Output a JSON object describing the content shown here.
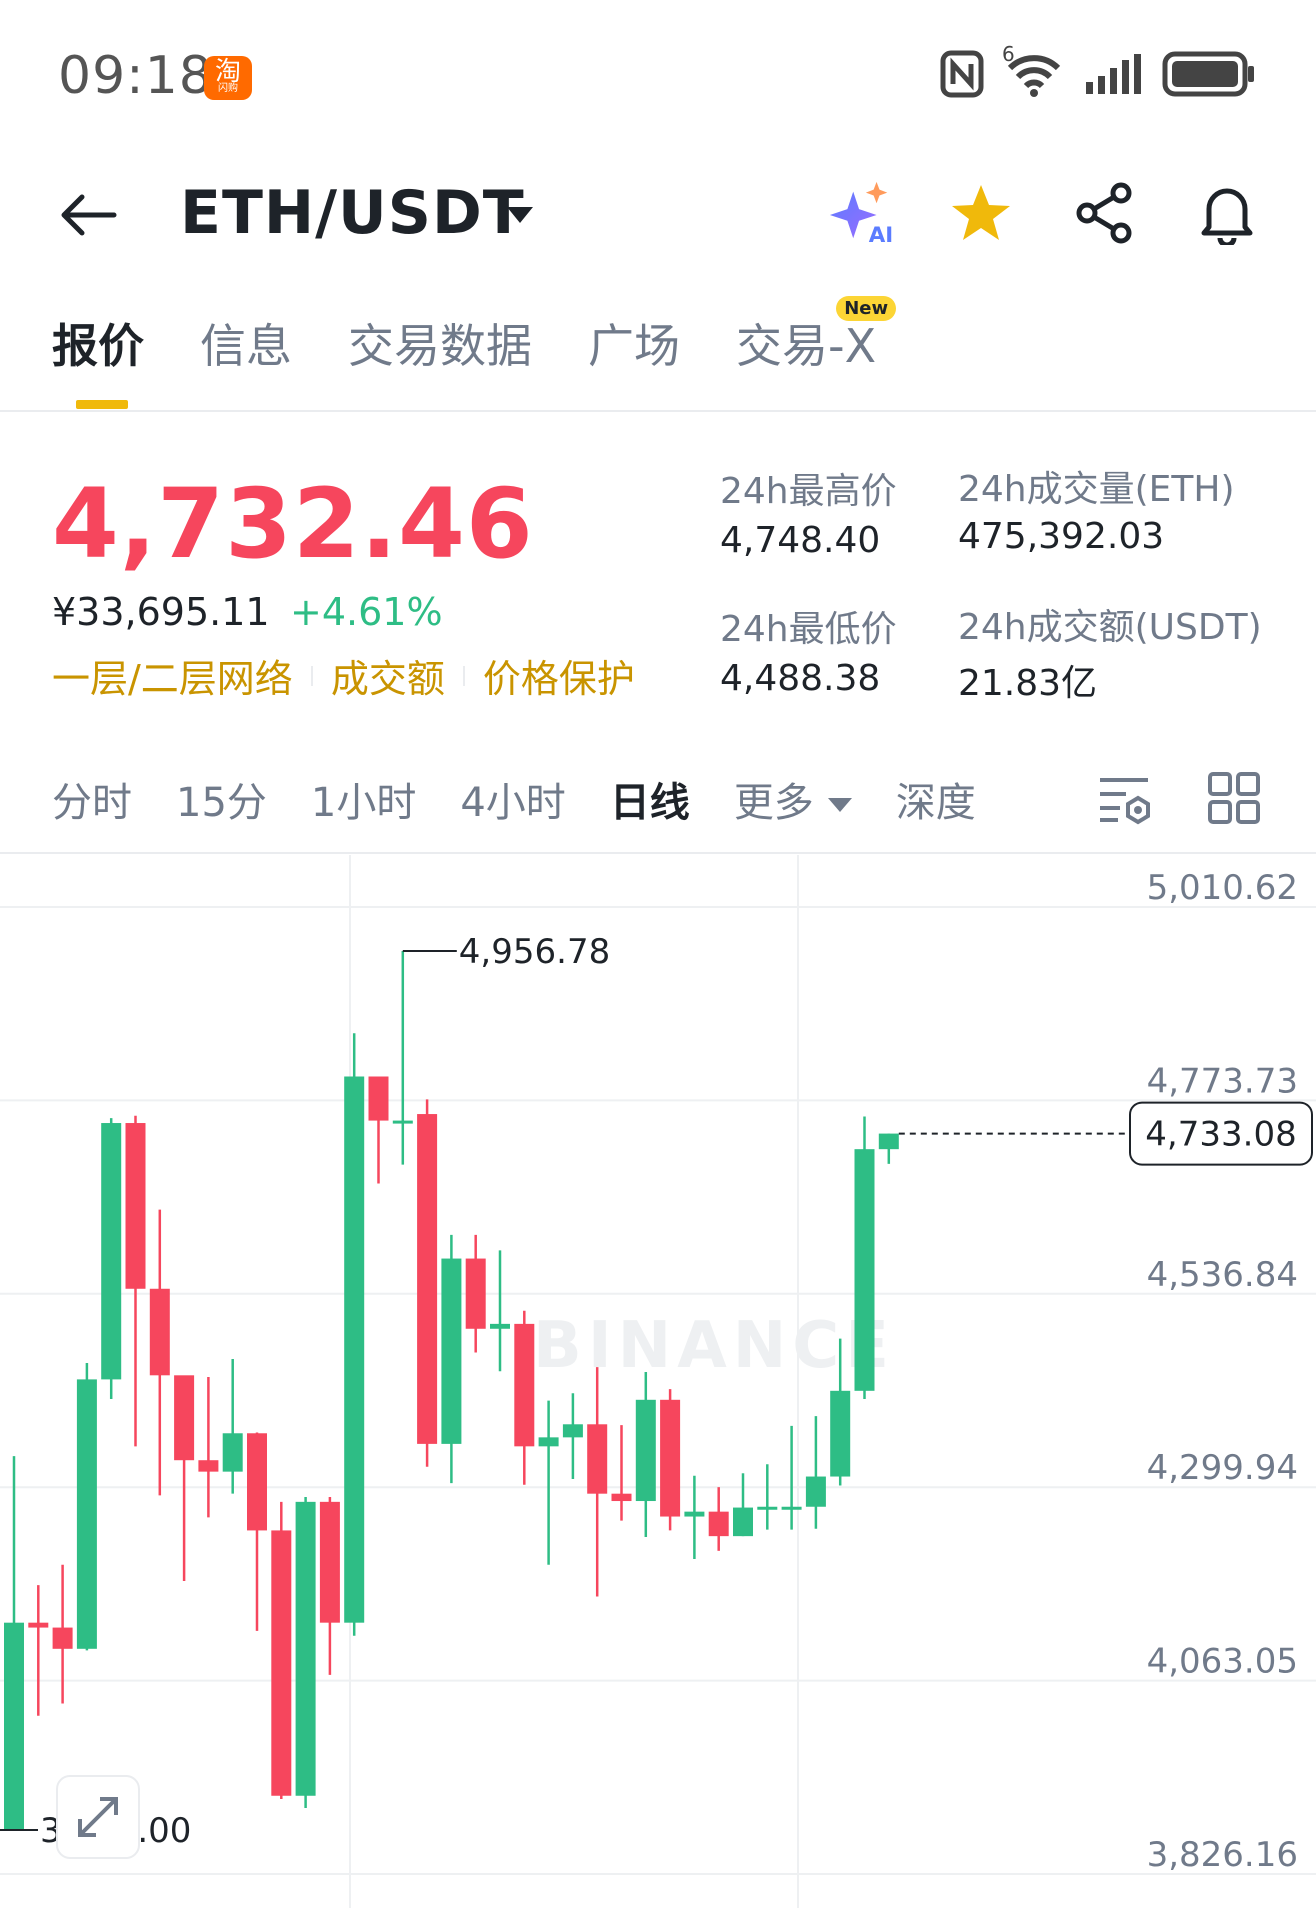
{
  "status_bar": {
    "time": "09:18",
    "app_badge": "淘",
    "app_badge_sub": "闪购",
    "wifi_generation": "6"
  },
  "header": {
    "pair": "ETH/USDT",
    "icons": [
      "back-arrow-icon",
      "ai-sparkle-icon",
      "star-icon",
      "share-icon",
      "bell-icon"
    ],
    "ai_badge": "AI"
  },
  "tabs": [
    {
      "label": "报价",
      "active": true
    },
    {
      "label": "信息"
    },
    {
      "label": "交易数据"
    },
    {
      "label": "广场"
    },
    {
      "label": "交易-X",
      "badge": "New"
    }
  ],
  "ticker": {
    "last_price": "4,732.46",
    "cny_price": "¥33,695.11",
    "change_pct": "+4.61%",
    "links": [
      "一层/二层网络",
      "成交额",
      "价格保护"
    ],
    "high_label": "24h最高价",
    "high_value": "4,748.40",
    "low_label": "24h最低价",
    "low_value": "4,488.38",
    "vol_base_label": "24h成交量(ETH)",
    "vol_base_value": "475,392.03",
    "vol_quote_label": "24h成交额(USDT)",
    "vol_quote_value": "21.83亿"
  },
  "intervals": {
    "items": [
      "分时",
      "15分",
      "1小时",
      "4小时",
      "日线",
      "更多",
      "深度"
    ],
    "active": "日线"
  },
  "colors": {
    "up": "#2ebd85",
    "down": "#f6465d",
    "accent": "#f0b90b",
    "link": "#c99400"
  },
  "chart_data": {
    "type": "candlestick",
    "interval": "日线",
    "watermark": "BINANCE",
    "y_ticks": [
      5010.62,
      4773.73,
      4536.84,
      4299.94,
      4063.05,
      3826.16
    ],
    "y_tick_labels": [
      "5,010.62",
      "4,773.73",
      "4,536.84",
      "4,299.94",
      "4,063.05",
      "3,826.16"
    ],
    "ylim": [
      3826.16,
      5010.62
    ],
    "high_marker": {
      "label": "4,956.78",
      "value": 4956.78
    },
    "low_marker": {
      "label": "3,880.00",
      "value": 3880.0
    },
    "current_price": {
      "label": "4,733.08",
      "value": 4733.08
    },
    "candles": [
      {
        "o": 3880,
        "h": 4338,
        "l": 3880,
        "c": 4134
      },
      {
        "o": 4134,
        "h": 4180,
        "l": 4020,
        "c": 4128
      },
      {
        "o": 4128,
        "h": 4205,
        "l": 4035,
        "c": 4102
      },
      {
        "o": 4102,
        "h": 4452,
        "l": 4100,
        "c": 4432
      },
      {
        "o": 4432,
        "h": 4752,
        "l": 4408,
        "c": 4746
      },
      {
        "o": 4746,
        "h": 4755,
        "l": 4350,
        "c": 4543
      },
      {
        "o": 4543,
        "h": 4640,
        "l": 4290,
        "c": 4437
      },
      {
        "o": 4437,
        "h": 4412,
        "l": 4185,
        "c": 4333
      },
      {
        "o": 4333,
        "h": 4435,
        "l": 4263,
        "c": 4319
      },
      {
        "o": 4319,
        "h": 4457,
        "l": 4292,
        "c": 4366
      },
      {
        "o": 4366,
        "h": 4367,
        "l": 4124,
        "c": 4247
      },
      {
        "o": 4247,
        "h": 4282,
        "l": 3918,
        "c": 3922
      },
      {
        "o": 3922,
        "h": 4288,
        "l": 3907,
        "c": 4282
      },
      {
        "o": 4282,
        "h": 4288,
        "l": 4070,
        "c": 4134
      },
      {
        "o": 4134,
        "h": 4856,
        "l": 4118,
        "c": 4803
      },
      {
        "o": 4803,
        "h": 4803,
        "l": 4672,
        "c": 4749
      },
      {
        "o": 4749,
        "h": 4956.78,
        "l": 4695,
        "c": 4749
      },
      {
        "o": 4757,
        "h": 4775,
        "l": 4325,
        "c": 4353
      },
      {
        "o": 4353,
        "h": 4609,
        "l": 4305,
        "c": 4580
      },
      {
        "o": 4580,
        "h": 4609,
        "l": 4465,
        "c": 4494
      },
      {
        "o": 4494,
        "h": 4590,
        "l": 4442,
        "c": 4500
      },
      {
        "o": 4500,
        "h": 4516,
        "l": 4303,
        "c": 4350
      },
      {
        "o": 4350,
        "h": 4406,
        "l": 4205,
        "c": 4361
      },
      {
        "o": 4361,
        "h": 4415,
        "l": 4310,
        "c": 4377
      },
      {
        "o": 4377,
        "h": 4447,
        "l": 4166,
        "c": 4292
      },
      {
        "o": 4292,
        "h": 4376,
        "l": 4259,
        "c": 4283
      },
      {
        "o": 4283,
        "h": 4441,
        "l": 4239,
        "c": 4407
      },
      {
        "o": 4407,
        "h": 4420,
        "l": 4247,
        "c": 4264
      },
      {
        "o": 4264,
        "h": 4314,
        "l": 4212,
        "c": 4270
      },
      {
        "o": 4270,
        "h": 4300,
        "l": 4222,
        "c": 4240
      },
      {
        "o": 4240,
        "h": 4317,
        "l": 4240,
        "c": 4275
      },
      {
        "o": 4275,
        "h": 4328,
        "l": 4248,
        "c": 4276
      },
      {
        "o": 4276,
        "h": 4375,
        "l": 4248,
        "c": 4276
      },
      {
        "o": 4276,
        "h": 4387,
        "l": 4249,
        "c": 4313
      },
      {
        "o": 4313,
        "h": 4482,
        "l": 4302,
        "c": 4418
      },
      {
        "o": 4418,
        "h": 4754,
        "l": 4408,
        "c": 4714
      },
      {
        "o": 4714,
        "h": 4733.08,
        "l": 4696,
        "c": 4733.08
      }
    ]
  }
}
